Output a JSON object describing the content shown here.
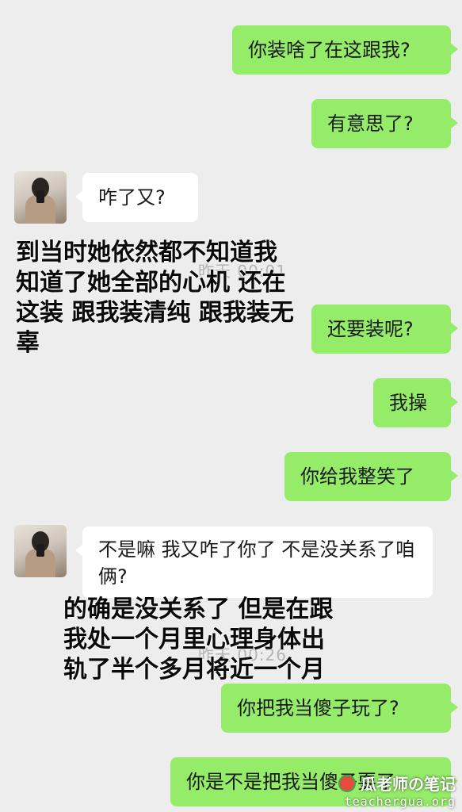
{
  "timestamps": [
    "昨天 00:01",
    "昨天 00:26"
  ],
  "messages": [
    {
      "from": "me",
      "text": "你装啥了在这跟我?"
    },
    {
      "from": "me",
      "text": "有意思了?"
    },
    {
      "from": "them",
      "text": "咋了又?"
    },
    {
      "from": "me",
      "text": "还要装呢?"
    },
    {
      "from": "me",
      "text": "我操"
    },
    {
      "from": "me",
      "text": "你给我整笑了"
    },
    {
      "from": "them",
      "text": "不是嘛  我又咋了你了  不是没关系了咱俩?"
    },
    {
      "from": "me",
      "text": "你把我当傻子玩了?"
    },
    {
      "from": "me",
      "text": "你是不是把我当傻子耍了"
    }
  ],
  "annotations": [
    "到当时她依然都不知道我\n知道了她全部的心机 还在\n这装 跟我装清纯 跟我装无\n辜",
    "的确是没关系了 但是在跟\n我处一个月里心理身体出\n轨了半个多月将近一个月"
  ],
  "watermark": {
    "name": "瓜老师の笔记",
    "site": "teachergua.org"
  },
  "colors": {
    "background": "#ededed",
    "my_bubble": "#95ec69",
    "their_bubble": "#ffffff"
  }
}
